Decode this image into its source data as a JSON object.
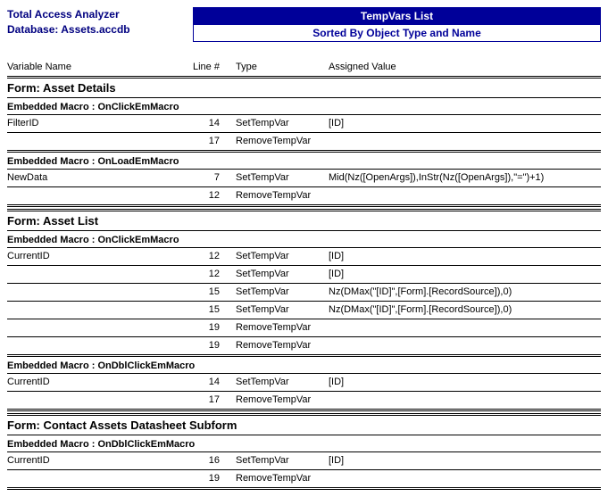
{
  "header": {
    "product": "Total Access Analyzer",
    "db_label": "Database:",
    "db_name": "Assets.accdb",
    "title": "TempVars List",
    "subtitle": "Sorted By Object Type and Name"
  },
  "columns": {
    "var": "Variable Name",
    "line": "Line #",
    "type": "Type",
    "val": "Assigned Value"
  },
  "sections": [
    {
      "title": "Form: Asset Details",
      "macros": [
        {
          "title": "Embedded Macro : OnClickEmMacro",
          "rows": [
            {
              "var": "FilterID",
              "line": "14",
              "type": "SetTempVar",
              "val": "[ID]"
            },
            {
              "var": "",
              "line": "17",
              "type": "RemoveTempVar",
              "val": ""
            }
          ]
        },
        {
          "title": "Embedded Macro : OnLoadEmMacro",
          "rows": [
            {
              "var": "NewData",
              "line": "7",
              "type": "SetTempVar",
              "val": "Mid(Nz([OpenArgs]),InStr(Nz([OpenArgs]),\"=\")+1)"
            },
            {
              "var": "",
              "line": "12",
              "type": "RemoveTempVar",
              "val": ""
            }
          ]
        }
      ]
    },
    {
      "title": "Form: Asset List",
      "macros": [
        {
          "title": "Embedded Macro : OnClickEmMacro",
          "rows": [
            {
              "var": "CurrentID",
              "line": "12",
              "type": "SetTempVar",
              "val": "[ID]"
            },
            {
              "var": "",
              "line": "12",
              "type": "SetTempVar",
              "val": "[ID]"
            },
            {
              "var": "",
              "line": "15",
              "type": "SetTempVar",
              "val": "Nz(DMax(\"[ID]\",[Form].[RecordSource]),0)"
            },
            {
              "var": "",
              "line": "15",
              "type": "SetTempVar",
              "val": "Nz(DMax(\"[ID]\",[Form].[RecordSource]),0)"
            },
            {
              "var": "",
              "line": "19",
              "type": "RemoveTempVar",
              "val": ""
            },
            {
              "var": "",
              "line": "19",
              "type": "RemoveTempVar",
              "val": ""
            }
          ]
        },
        {
          "title": "Embedded Macro : OnDblClickEmMacro",
          "rows": [
            {
              "var": "CurrentID",
              "line": "14",
              "type": "SetTempVar",
              "val": "[ID]"
            },
            {
              "var": "",
              "line": "17",
              "type": "RemoveTempVar",
              "val": ""
            }
          ]
        }
      ]
    },
    {
      "title": "Form: Contact Assets Datasheet Subform",
      "macros": [
        {
          "title": "Embedded Macro : OnDblClickEmMacro",
          "rows": [
            {
              "var": "CurrentID",
              "line": "16",
              "type": "SetTempVar",
              "val": "[ID]"
            },
            {
              "var": "",
              "line": "19",
              "type": "RemoveTempVar",
              "val": ""
            }
          ]
        }
      ]
    }
  ]
}
